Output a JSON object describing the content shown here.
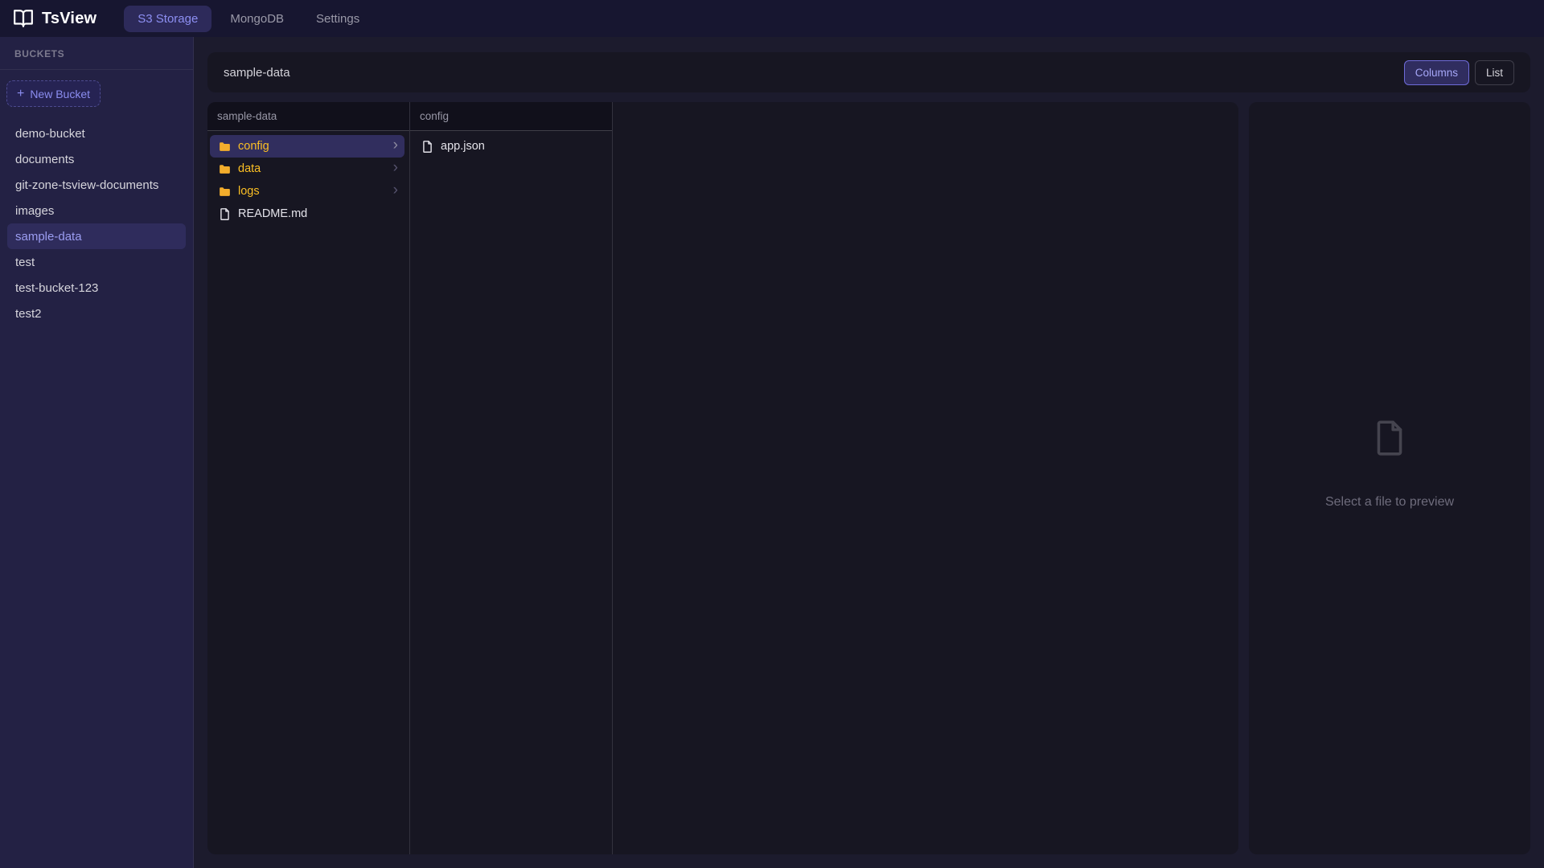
{
  "nav": {
    "app_name": "TsView",
    "tabs": [
      {
        "label": "S3 Storage",
        "active": true
      },
      {
        "label": "MongoDB",
        "active": false
      },
      {
        "label": "Settings",
        "active": false
      }
    ]
  },
  "sidebar": {
    "heading": "BUCKETS",
    "new_bucket_label": "New Bucket",
    "new_bucket_icon": "+",
    "buckets": [
      {
        "name": "demo-bucket",
        "selected": false
      },
      {
        "name": "documents",
        "selected": false
      },
      {
        "name": "git-zone-tsview-documents",
        "selected": false
      },
      {
        "name": "images",
        "selected": false
      },
      {
        "name": "sample-data",
        "selected": true
      },
      {
        "name": "test",
        "selected": false
      },
      {
        "name": "test-bucket-123",
        "selected": false
      },
      {
        "name": "test2",
        "selected": false
      }
    ]
  },
  "main": {
    "title": "sample-data",
    "view_toggle": {
      "columns_label": "Columns",
      "list_label": "List",
      "active": "Columns"
    },
    "columns": [
      {
        "header": "sample-data",
        "items": [
          {
            "name": "config",
            "type": "folder",
            "selected": true
          },
          {
            "name": "data",
            "type": "folder",
            "selected": false
          },
          {
            "name": "logs",
            "type": "folder",
            "selected": false
          },
          {
            "name": "README.md",
            "type": "file",
            "selected": false
          }
        ]
      },
      {
        "header": "config",
        "items": [
          {
            "name": "app.json",
            "type": "file",
            "selected": false
          }
        ]
      }
    ],
    "preview": {
      "placeholder": "Select a file to preview"
    }
  },
  "icons": {
    "chevron_right": "›"
  },
  "colors": {
    "accent_indigo": "#6e6bd8",
    "selection_bg": "#2f2c5c",
    "selection_text": "#9b9df1",
    "folder_amber": "#fbbf24",
    "panel_bg": "#171622",
    "sidebar_bg": "#232144",
    "nav_bg": "#171630",
    "page_bg": "#1c1b2d"
  }
}
